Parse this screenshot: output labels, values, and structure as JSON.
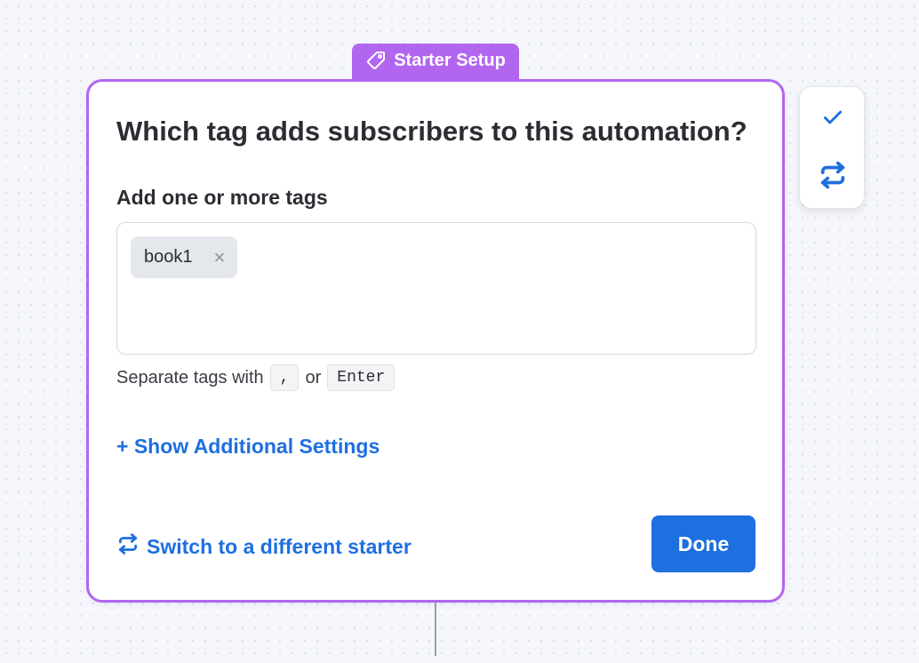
{
  "badge": {
    "icon": "tag-icon",
    "label": "Starter Setup",
    "color": "#b266f0"
  },
  "card": {
    "title": "Which tag adds subscribers to this automation?",
    "field_label": "Add one or more tags",
    "tags": [
      {
        "label": "book1",
        "remove_icon": "×"
      }
    ],
    "hint": {
      "prefix": "Separate tags with",
      "key1": ",",
      "middle": "or",
      "key2": "Enter"
    },
    "show_settings_label": "+ Show Additional Settings",
    "switch_label": "Switch to a different starter",
    "done_label": "Done"
  },
  "side_panel": {
    "confirm_icon": "check-icon",
    "switch_icon": "repeat-icon"
  },
  "colors": {
    "accent_purple": "#b266f0",
    "link_blue": "#1e6fe0",
    "text": "#2b2d33"
  }
}
